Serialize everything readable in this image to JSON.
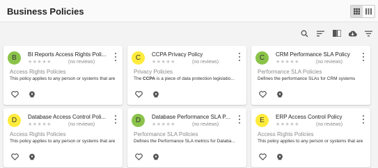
{
  "header": {
    "title": "Business Policies"
  },
  "view_toggle": {
    "active": "grid"
  },
  "toolbar": [
    "search-icon",
    "sort-icon",
    "library-icon",
    "cloud-download-icon",
    "filter-icon"
  ],
  "cards": [
    {
      "avatar": "B",
      "avatar_color": "#8bc34a",
      "title": "BI Reports Access Rights Poli...",
      "stars": "★★★★★",
      "reviews": "(no reviews)",
      "category": "Access Rights Policies",
      "desc_pre": "This policy applies to any person or systems that are",
      "desc_bold": "",
      "desc_post": ""
    },
    {
      "avatar": "C",
      "avatar_color": "#ffeb3b",
      "title": "CCPA Privacy Policy",
      "stars": "★★★★★",
      "reviews": "(no reviews)",
      "category": "Privacy Policies",
      "desc_pre": "The ",
      "desc_bold": "CCPA",
      "desc_post": " is a piece of data protection legislatio..."
    },
    {
      "avatar": "C",
      "avatar_color": "#8bc34a",
      "title": "CRM Performance SLA Policy",
      "stars": "★★★★★",
      "reviews": "(no reviews)",
      "category": "Performance SLA Policies",
      "desc_pre": "Defines the performance SLAs for CRM systems",
      "desc_bold": "",
      "desc_post": ""
    },
    {
      "avatar": "D",
      "avatar_color": "#ffeb3b",
      "title": "Database Access Control Poli...",
      "stars": "★★★★★",
      "reviews": "(no reviews)",
      "category": "Access Rights Policies",
      "desc_pre": "This policy applies to any person or systems that are",
      "desc_bold": "",
      "desc_post": ""
    },
    {
      "avatar": "D",
      "avatar_color": "#8bc34a",
      "title": "Database Performance SLA P...",
      "stars": "★★★★★",
      "reviews": "(no reviews)",
      "category": "Performance SLA Policies",
      "desc_pre": "Defines the Performance SLA metrics for Databa...",
      "desc_bold": "",
      "desc_post": ""
    },
    {
      "avatar": "E",
      "avatar_color": "#ffeb3b",
      "title": "ERP Access Control Policy",
      "stars": "★★★★★",
      "reviews": "(no reviews)",
      "category": "Access Rights Policies",
      "desc_pre": "This policy applies to any person or systems that are",
      "desc_bold": "",
      "desc_post": ""
    }
  ],
  "card_actions": [
    "favorite-icon",
    "bulb-icon"
  ]
}
